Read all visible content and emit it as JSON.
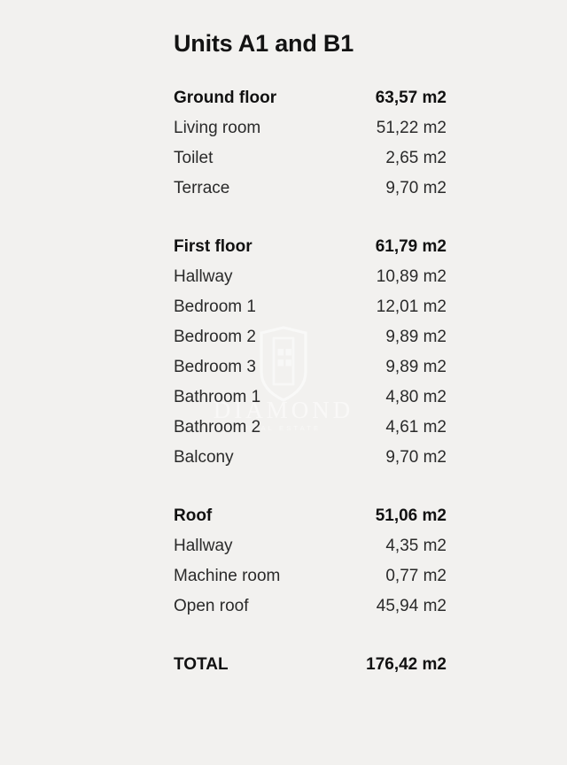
{
  "document": {
    "title": "Units A1 and B1",
    "unit": "m2"
  },
  "watermark": {
    "mark_icon": "shield-building-icon",
    "word": "DIAMOND",
    "subtitle": "REAL ESTATE"
  },
  "groups": [
    {
      "name": "ground-floor",
      "header": {
        "label": "Ground floor",
        "value": "63,57 m2"
      },
      "rows": [
        {
          "label": "Living room",
          "value": "51,22 m2"
        },
        {
          "label": "Toilet",
          "value": "2,65 m2"
        },
        {
          "label": "Terrace",
          "value": "9,70 m2"
        }
      ]
    },
    {
      "name": "first-floor",
      "header": {
        "label": "First floor",
        "value": "61,79 m2"
      },
      "rows": [
        {
          "label": "Hallway",
          "value": "10,89 m2"
        },
        {
          "label": "Bedroom 1",
          "value": "12,01 m2"
        },
        {
          "label": "Bedroom 2",
          "value": "9,89 m2"
        },
        {
          "label": "Bedroom 3",
          "value": "9,89 m2"
        },
        {
          "label": "Bathroom 1",
          "value": "4,80 m2"
        },
        {
          "label": "Bathroom 2",
          "value": "4,61 m2"
        },
        {
          "label": "Balcony",
          "value": "9,70 m2"
        }
      ]
    },
    {
      "name": "roof",
      "header": {
        "label": "Roof",
        "value": "51,06 m2"
      },
      "rows": [
        {
          "label": "Hallway",
          "value": "4,35 m2"
        },
        {
          "label": "Machine room",
          "value": "0,77 m2"
        },
        {
          "label": "Open roof",
          "value": "45,94 m2"
        }
      ]
    }
  ],
  "total": {
    "label": "TOTAL",
    "value": "176,42 m2"
  },
  "colors": {
    "background": "#f2f1ef",
    "text": "#2a2a2a",
    "heading": "#111111",
    "watermark": "#ffffff"
  }
}
